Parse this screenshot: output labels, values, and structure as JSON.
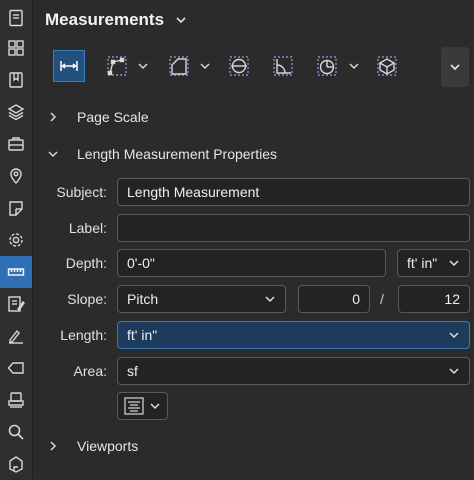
{
  "rail": {
    "items": [
      {
        "name": "document-icon"
      },
      {
        "name": "thumbnails-icon"
      },
      {
        "name": "bookmarks-icon"
      },
      {
        "name": "layers-icon"
      },
      {
        "name": "toolchest-icon"
      },
      {
        "name": "places-icon"
      },
      {
        "name": "properties-icon"
      },
      {
        "name": "settings-icon"
      },
      {
        "name": "measurements-icon",
        "active": true
      },
      {
        "name": "markups-list-icon"
      },
      {
        "name": "signatures-icon"
      },
      {
        "name": "tags-icon"
      },
      {
        "name": "stamps-icon"
      },
      {
        "name": "search-icon"
      },
      {
        "name": "spaces-icon"
      }
    ]
  },
  "panel": {
    "title": "Measurements"
  },
  "toolbar": {
    "tools": [
      {
        "name": "length-tool",
        "selected": true
      },
      {
        "name": "polylength-tool",
        "dropdown": true
      },
      {
        "name": "area-tool",
        "dropdown": true
      },
      {
        "name": "diameter-tool"
      },
      {
        "name": "angle-tool"
      },
      {
        "name": "radius-tool",
        "dropdown": true
      },
      {
        "name": "volume-tool"
      }
    ]
  },
  "sections": {
    "page_scale": "Page Scale",
    "length_props": "Length Measurement Properties",
    "viewports": "Viewports"
  },
  "form": {
    "subject_label": "Subject:",
    "subject_value": "Length Measurement",
    "label_label": "Label:",
    "label_value": "",
    "depth_label": "Depth:",
    "depth_value": "0'-0\"",
    "depth_unit": "ft' in\"",
    "slope_label": "Slope:",
    "slope_type": "Pitch",
    "slope_rise": "0",
    "slope_sep": "/",
    "slope_run": "12",
    "length_label": "Length:",
    "length_unit": "ft' in\"",
    "area_label": "Area:",
    "area_unit": "sf"
  },
  "colors": {
    "accent": "#2f6fb3",
    "background": "#2b2b2b",
    "field": "#232323",
    "focused_field": "#1d3b5c"
  }
}
